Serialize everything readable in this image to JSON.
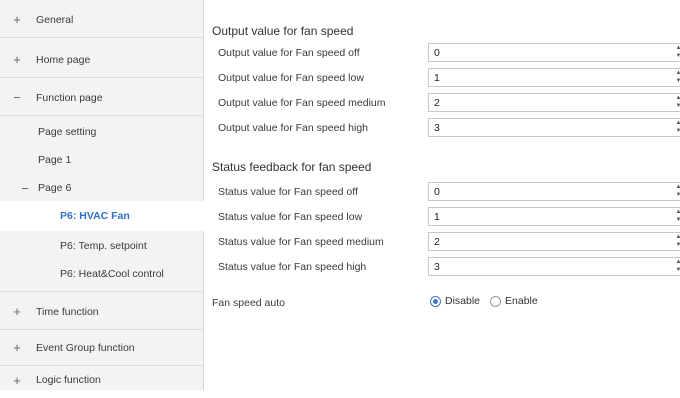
{
  "sidebar": {
    "items": [
      {
        "sign": "+",
        "label": "General"
      },
      {
        "sign": "+",
        "label": "Home page"
      },
      {
        "sign": "−",
        "label": "Function page"
      },
      {
        "sign": "",
        "label": "Page setting"
      },
      {
        "sign": "",
        "label": "Page 1"
      },
      {
        "sign": "−",
        "label": "Page 6"
      },
      {
        "sign": "",
        "label": "P6: HVAC Fan"
      },
      {
        "sign": "",
        "label": "P6: Temp. setpoint"
      },
      {
        "sign": "",
        "label": "P6: Heat&Cool control"
      },
      {
        "sign": "+",
        "label": "Time function"
      },
      {
        "sign": "+",
        "label": "Event Group function"
      },
      {
        "sign": "+",
        "label": "Logic function"
      }
    ],
    "selected_color": "#2f72c4"
  },
  "main": {
    "output_section": {
      "title": "Output value for fan speed",
      "rows": [
        {
          "label": "Output value for Fan speed off",
          "value": "0"
        },
        {
          "label": "Output value for Fan speed low",
          "value": "1"
        },
        {
          "label": "Output value for Fan speed medium",
          "value": "2"
        },
        {
          "label": "Output value for Fan speed high",
          "value": "3"
        }
      ]
    },
    "status_section": {
      "title": "Status feedback for fan speed",
      "rows": [
        {
          "label": "Status value for Fan speed off",
          "value": "0"
        },
        {
          "label": "Status value for Fan speed low",
          "value": "1"
        },
        {
          "label": "Status value for Fan speed medium",
          "value": "2"
        },
        {
          "label": "Status value for Fan speed high",
          "value": "3"
        }
      ]
    },
    "fan_speed_auto": {
      "label": "Fan speed auto",
      "options": [
        "Disable",
        "Enable"
      ],
      "selected": "Disable"
    },
    "spinner_up": "▲",
    "spinner_down": "▼"
  }
}
